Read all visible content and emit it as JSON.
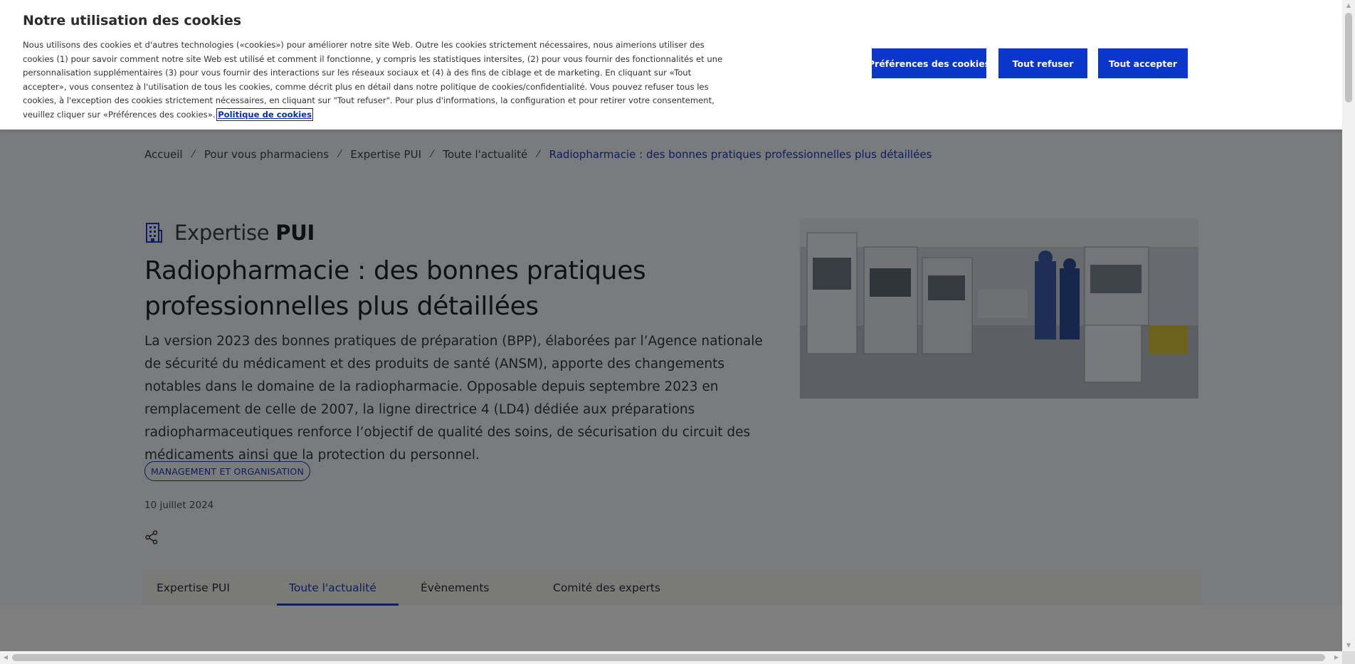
{
  "cookie_banner": {
    "title": "Notre utilisation des cookies",
    "text": "Nous utilisons des cookies et d'autres technologies («cookies») pour améliorer notre site Web. Outre les cookies strictement nécessaires, nous aimerions utiliser des cookies (1) pour savoir comment notre site Web est utilisé et comment il fonctionne, y compris les statistiques intersites, (2) pour vous fournir des fonctionnalités et une personnalisation supplémentaires (3) pour vous fournir des interactions sur les réseaux sociaux et (4) à des fins de ciblage et de marketing. En cliquant sur «Tout accepter», vous consentez à l'utilisation de tous les cookies, comme décrit plus en détail dans notre politique de cookies/confidentialité. Vous pouvez refuser tous les cookies, à l'exception des cookies strictement nécessaires, en cliquant sur \"Tout refuser\". Pour plus d'informations, la configuration et pour retirer votre consentement, veuillez cliquer sur «Préférences des cookies».",
    "policy_link": "Politique de cookies",
    "buttons": {
      "preferences": "Préférences des cookies",
      "reject_all": "Tout refuser",
      "accept_all": "Tout accepter"
    }
  },
  "breadcrumb": {
    "items": [
      "Accueil",
      "Pour vous pharmaciens",
      "Expertise PUI",
      "Toute l'actualité"
    ],
    "current": "Radiopharmacie : des bonnes pratiques professionnelles plus détaillées",
    "separator": "⁄"
  },
  "section": {
    "name_prefix": "Expertise",
    "name_strong": "PUI",
    "icon": "building-icon"
  },
  "article": {
    "title": "Radiopharmacie : des bonnes pratiques professionnelles plus détaillées",
    "lead": "La version 2023 des bonnes pratiques de préparation (BPP), élaborées par l’Agence nationale de sécurité du médicament et des produits de santé (ANSM), apporte des changements notables dans le domaine de la radiopharmacie. Opposable depuis septembre 2023 en remplacement de celle de 2007, la ligne directrice 4 (LD4) dédiée aux préparations radiopharmaceutiques renforce l’objectif de qualité des soins, de sécurisation du circuit des médicaments ainsi que la protection du personnel.",
    "tag": "MANAGEMENT ET ORGANISATION",
    "date": "10 juillet 2024",
    "share_icon": "share-icon"
  },
  "tabs": [
    {
      "label": "Expertise PUI",
      "active": false
    },
    {
      "label": "Toute l'actualité",
      "active": true
    },
    {
      "label": "Évènements",
      "active": false
    },
    {
      "label": "Comité des experts",
      "active": false
    }
  ],
  "colors": {
    "accent": "#0b36cc",
    "link": "#1b3bbf",
    "overlay": "rgba(0,0,0,0.5)"
  }
}
